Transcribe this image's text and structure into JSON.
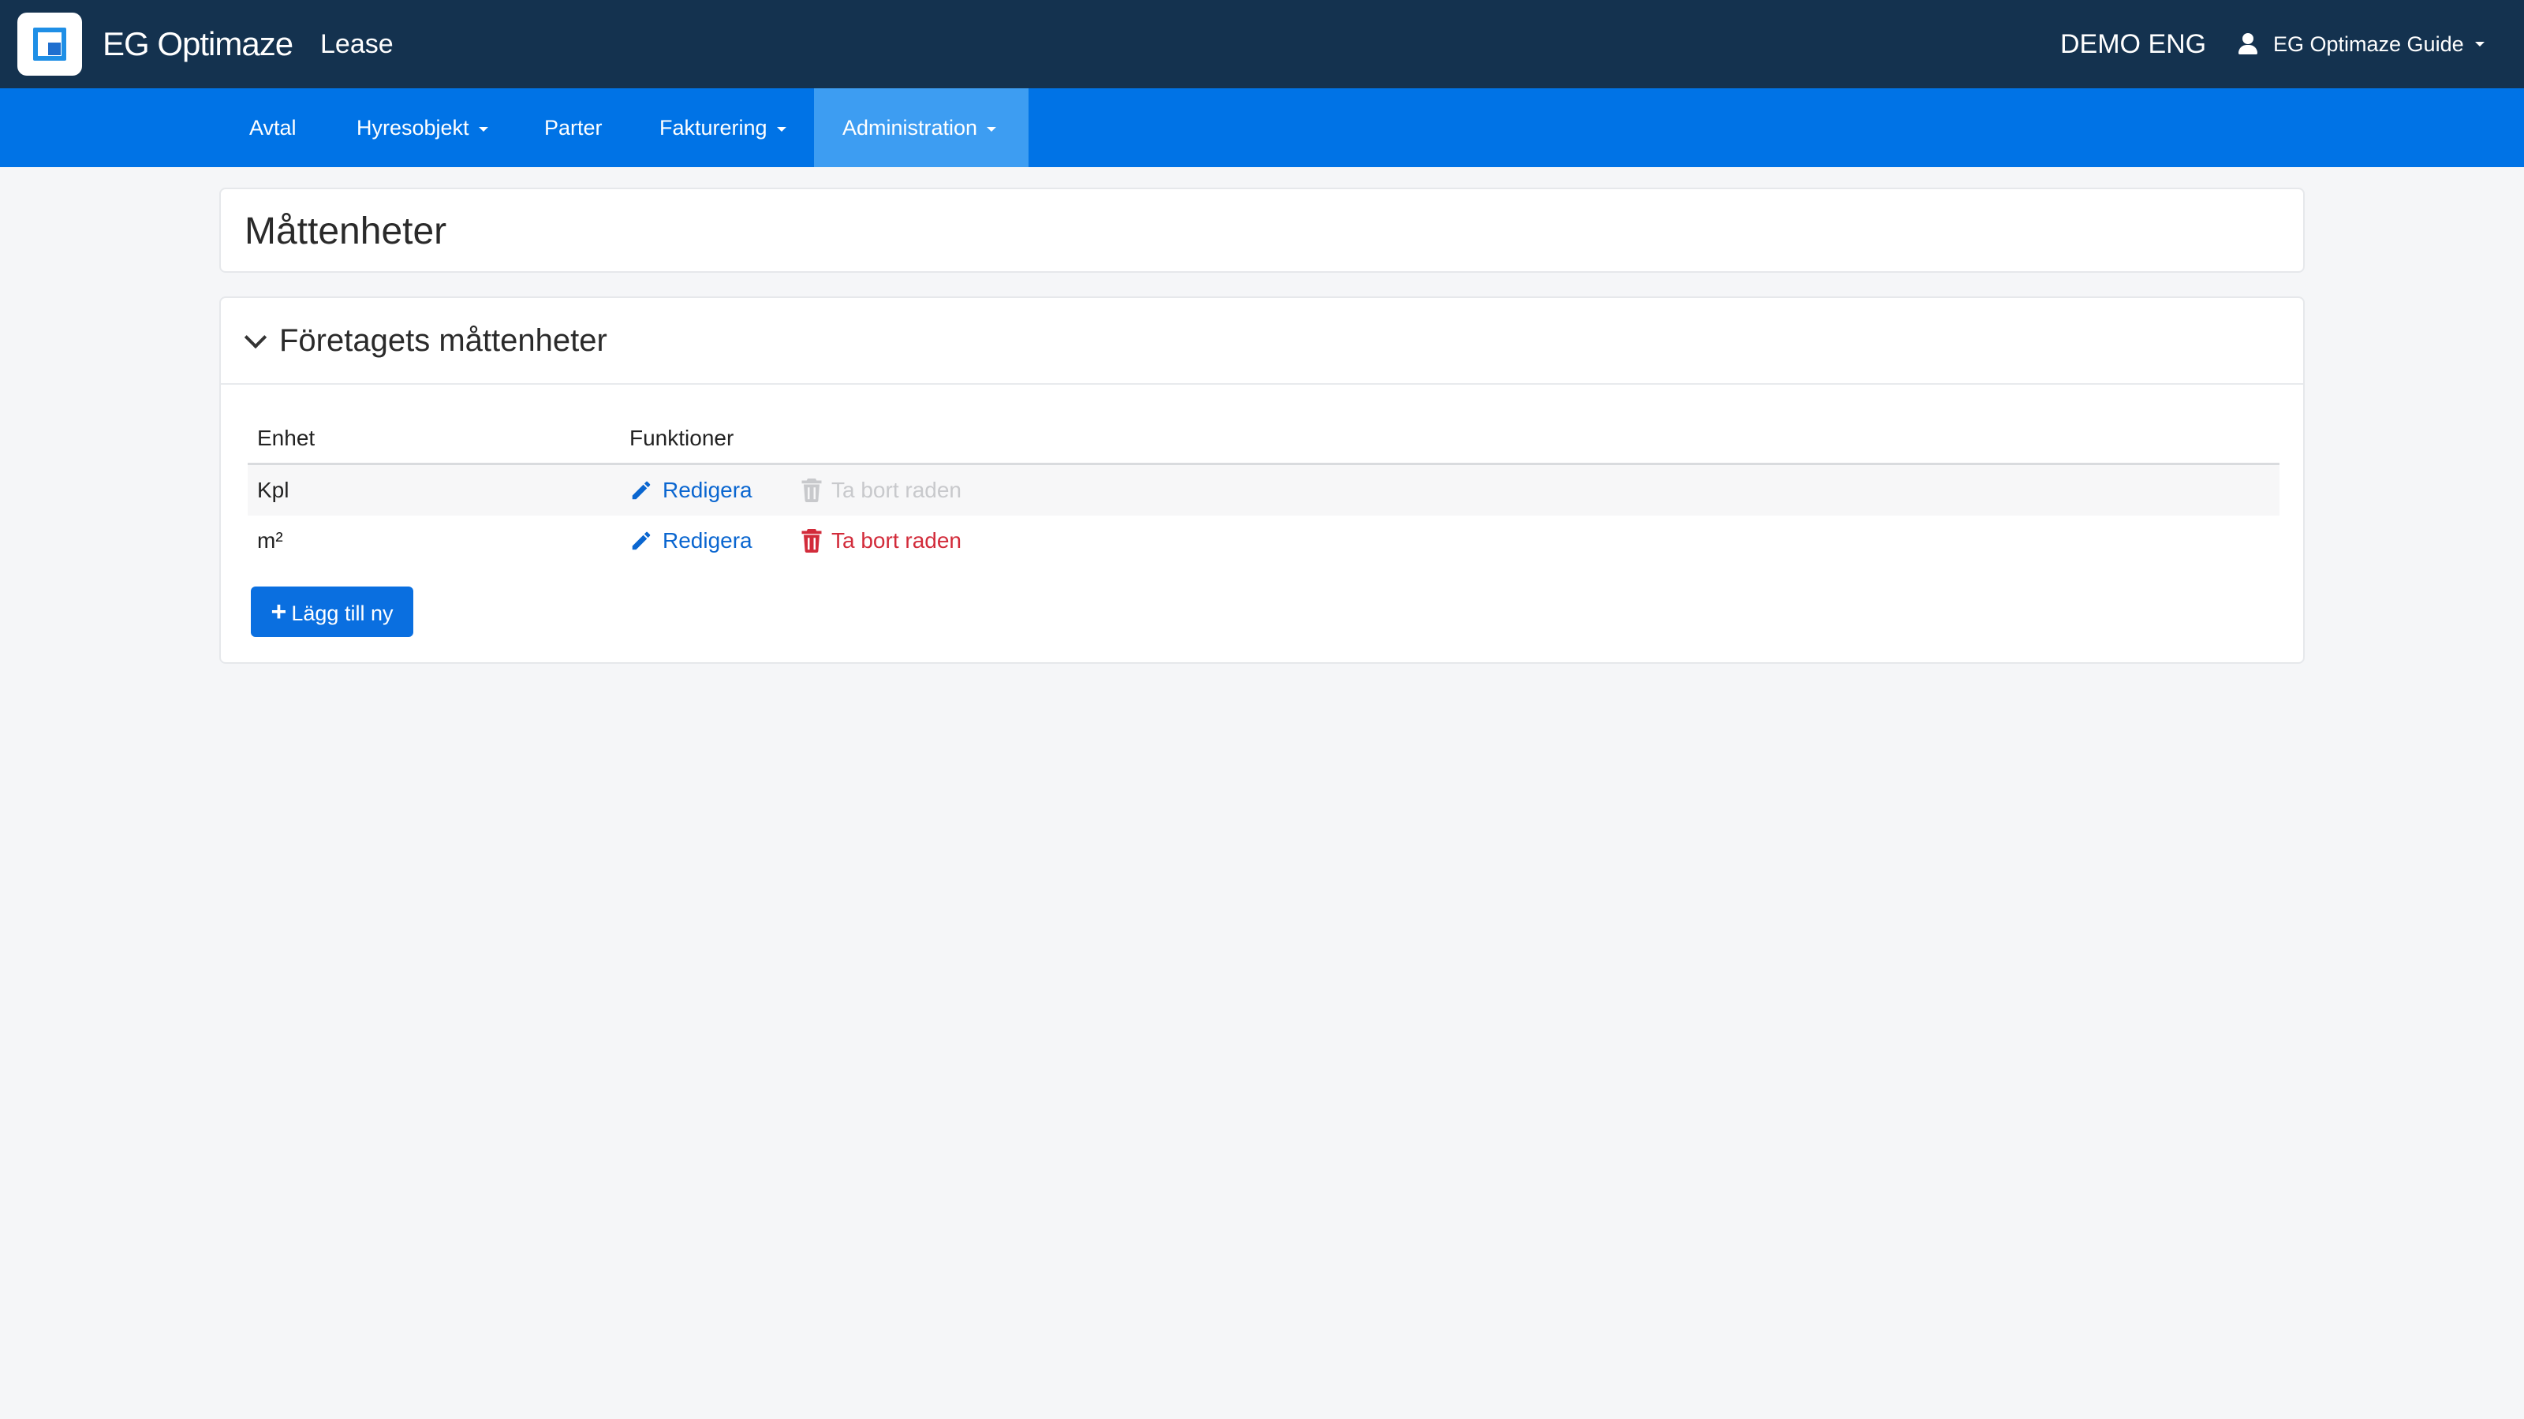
{
  "header": {
    "brand": "EG Optimaze",
    "app": "Lease",
    "environment": "DEMO ENG",
    "user": "EG Optimaze Guide"
  },
  "nav": {
    "items": [
      {
        "label": "Avtal"
      },
      {
        "label": "Hyresobjekt"
      },
      {
        "label": "Parter"
      },
      {
        "label": "Fakturering"
      },
      {
        "label": "Administration"
      }
    ]
  },
  "page": {
    "title": "Måttenheter"
  },
  "section": {
    "title": "Företagets måttenheter",
    "columns": [
      "Enhet",
      "Funktioner"
    ],
    "rows": [
      {
        "unit": "Kpl",
        "edit": "Redigera",
        "delete": "Ta bort raden"
      },
      {
        "unit": "m²",
        "edit": "Redigera",
        "delete": "Ta bort raden"
      }
    ],
    "add_button": "Lägg till ny"
  },
  "colors": {
    "topbar": "#14324f",
    "navbar": "#0073e6",
    "nav_active": "#3d9df2",
    "primary": "#0a6fe0",
    "danger": "#d22b3a",
    "disabled": "#c8c9cc"
  },
  "icons": [
    "app-logo-icon",
    "user-icon",
    "caret-down-icon",
    "chevron-down-icon",
    "pencil-icon",
    "trash-icon",
    "plus-icon"
  ]
}
